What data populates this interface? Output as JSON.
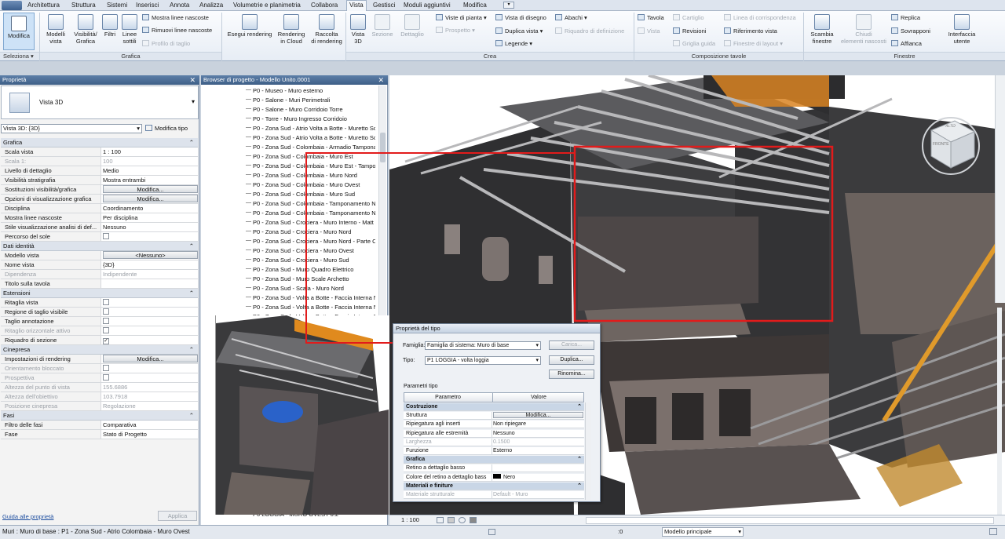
{
  "tabs": [
    "Architettura",
    "Struttura",
    "Sistemi",
    "Inserisci",
    "Annota",
    "Analizza",
    "Volumetrie e planimetria",
    "Collabora",
    "Vista",
    "Gestisci",
    "Moduli aggiuntivi",
    "Modifica"
  ],
  "ribbon": {
    "modifica": "Modifica",
    "seleziona": "Seleziona ▾",
    "modelli": "Modelli\nvista",
    "visibilita": "Visibilità/\nGrafica",
    "filtri": "Filtri",
    "linee": "Linee\nsottili",
    "mostra": "Mostra linee nascoste",
    "rimuovi": "Rimuovi linee nascoste",
    "profilo": "Profilo di taglio",
    "grafica": "Grafica",
    "esegui": "Esegui rendering",
    "cloud": "Rendering\nin Cloud",
    "raccolta": "Raccolta\ndi rendering",
    "vista3d": "Vista\n3D",
    "sezione": "Sezione",
    "dettaglio": "Dettaglio",
    "pianta": "Viste di pianta ▾",
    "prospetto": "Prospetto ▾",
    "vistadisegno": "Vista di disegno",
    "duplica": "Duplica vista ▾",
    "legende": "Legende ▾",
    "abachi": "Abachi ▾",
    "riquadro": "Riquadro di definizione",
    "crea": "Crea",
    "tavola": "Tavola",
    "vista": "Vista",
    "cartiglio": "Cartiglio",
    "revisioni": "Revisioni",
    "griglia": "Griglia guida",
    "corrispondenza": "Linea di corrispondenza",
    "riferimento": "Riferimento vista",
    "finestre": "Finestre di layout ▾",
    "composizione": "Composizione tavole",
    "scambia": "Scambia\nfinestre",
    "chiudi": "Chiudi\nelementi nascosti",
    "replica": "Replica",
    "sovrapponi": "Sovrapponi",
    "affianca": "Affianca",
    "interfaccia": "Interfaccia\nutente",
    "finestregrp": "Finestre"
  },
  "properties": {
    "title": "Proprietà",
    "type_name": "Vista 3D",
    "selector": "Vista 3D: {3D}",
    "edit_type": "Modifica tipo",
    "rows": [
      {
        "s": "Grafica"
      },
      {
        "k": "Scala vista",
        "v": "1 : 100"
      },
      {
        "k": "Scala 1:",
        "v": "100",
        "d": 1
      },
      {
        "k": "Livello di dettaglio",
        "v": "Medio"
      },
      {
        "k": "Visibilità stratigrafia",
        "v": "Mostra entrambi"
      },
      {
        "k": "Sostituzioni visibilità/grafica",
        "v": "Modifica...",
        "b": 1
      },
      {
        "k": "Opzioni di visualizzazione grafica",
        "v": "Modifica...",
        "b": 1
      },
      {
        "k": "Disciplina",
        "v": "Coordinamento"
      },
      {
        "k": "Mostra linee nascoste",
        "v": "Per disciplina"
      },
      {
        "k": "Stile visualizzazione analisi di def...",
        "v": "Nessuno"
      },
      {
        "k": "Percorso del sole",
        "c": ""
      },
      {
        "s": "Dati identità"
      },
      {
        "k": "Modello vista",
        "v": "<Nessuno>",
        "b": 1
      },
      {
        "k": "Nome vista",
        "v": "{3D}"
      },
      {
        "k": "Dipendenza",
        "v": "Indipendente",
        "d": 1
      },
      {
        "k": "Titolo sulla tavola",
        "v": ""
      },
      {
        "s": "Estensioni"
      },
      {
        "k": "Ritaglia vista",
        "c": ""
      },
      {
        "k": "Regione di taglio visibile",
        "c": ""
      },
      {
        "k": "Taglio annotazione",
        "c": ""
      },
      {
        "k": "Ritaglio orizzontale attivo",
        "c": "",
        "d": 1
      },
      {
        "k": "Riquadro di sezione",
        "c": "✓"
      },
      {
        "s": "Cinepresa"
      },
      {
        "k": "Impostazioni di rendering",
        "v": "Modifica...",
        "b": 1
      },
      {
        "k": "Orientamento bloccato",
        "c": "",
        "d": 1
      },
      {
        "k": "Prospettiva",
        "c": "",
        "d": 1
      },
      {
        "k": "Altezza del punto di vista",
        "v": "155.6886",
        "d": 1
      },
      {
        "k": "Altezza dell'obiettivo",
        "v": "103.7918",
        "d": 1
      },
      {
        "k": "Posizione cinepresa",
        "v": "Regolazione",
        "d": 1
      },
      {
        "s": "Fasi"
      },
      {
        "k": "Filtro delle fasi",
        "v": "Comparativa"
      },
      {
        "k": "Fase",
        "v": "Stato di Progetto"
      }
    ],
    "help": "Guida alle proprietà",
    "apply": "Applica"
  },
  "browser": {
    "title": "Browser di progetto - Modello Unito.0001",
    "items": [
      "P0 - Museo - Muro esterno",
      "P0 - Salone - Muri Perimetrali",
      "P0 - Salone - Muro Corridoio Torre",
      "P0 - Torre - Muro Ingresso Corridoio",
      "P0 - Zona Sud - Atrio Volta a Botte - Muretto Sc",
      "P0 - Zona Sud - Atrio Volta a Botte - Muretto Sc",
      "P0 - Zona Sud - Colombaia - Armadio Tampona",
      "P0 - Zona Sud - Colombaia - Muro Est",
      "P0 - Zona Sud - Colombaia - Muro Est - Tampo",
      "P0 - Zona Sud - Colombaia - Muro Nord",
      "P0 - Zona Sud - Colombaia - Muro Ovest",
      "P0 - Zona Sud - Colombaia - Muro Sud",
      "P0 - Zona Sud - Colombaia - Tamponamento N",
      "P0 - Zona Sud - Colombaia - Tamponamento N",
      "P0 - Zona Sud - Crociera - Muro Interno - Matt",
      "P0 - Zona Sud - Crociera - Muro Nord",
      "P0 - Zona Sud - Crociera - Muro Nord - Parte C",
      "P0 - Zona Sud - Crociera - Muro Ovest",
      "P0 - Zona Sud - Crociera - Muro Sud",
      "P0 - Zona Sud - Muro Quadro Elettrico",
      "P0 - Zona Sud - Muro Scale Archetto",
      "P0 - Zona Sud - Scala - Muro Nord",
      "P0 - Zona Sud - Volta a Botte - Faccia Interna N",
      "P0 - Zona Sud - Volta a Botte - Faccia Interna N",
      "P0 - Zona Sud - Volta a Botte - Faccia Interna N"
    ],
    "bottom": "P0 LOGGIA - MURO OVEST 0.2"
  },
  "viewcube": {
    "top": "ALTO",
    "front": "FRONTE"
  },
  "dialog": {
    "title": "Proprietà del tipo",
    "famiglia_lbl": "Famiglia:",
    "famiglia": "Famiglia di sistema: Muro di base",
    "tipo_lbl": "Tipo:",
    "tipo": "P1 LOGGIA - volta loggia",
    "carica": "Carica...",
    "duplica": "Duplica...",
    "rinomina": "Rinomina...",
    "parametri": "Parametri tipo",
    "col_p": "Parametro",
    "col_v": "Valore",
    "rows": [
      {
        "s": "Costruzione"
      },
      {
        "k": "Struttura",
        "v": "Modifica...",
        "b": 1
      },
      {
        "k": "Ripiegatura agli inserti",
        "v": "Non ripiegare"
      },
      {
        "k": "Ripiegatura alle estremità",
        "v": "Nessuno"
      },
      {
        "k": "Larghezza",
        "v": "0.1500",
        "d": 1
      },
      {
        "k": "Funzione",
        "v": "Esterno"
      },
      {
        "s": "Grafica"
      },
      {
        "k": "Retino a dettaglio basso",
        "v": ""
      },
      {
        "k": "Colore del retino a dettaglio bass",
        "v": "Nero"
      },
      {
        "s": "Materiali e finiture"
      },
      {
        "k": "Materiale strutturale",
        "v": "Default - Muro",
        "d": 1
      }
    ]
  },
  "viewbar": {
    "scale": "1 : 100"
  },
  "status": {
    "text": "Muri : Muro di base : P1 - Zona Sud - Atrio Colombaia - Muro Ovest",
    "model": "Modello principale",
    "zero": ":0"
  },
  "colors": {
    "selection": "#e21b1b",
    "ribbon": "#eef2f7",
    "panel_title": "#4a6b93",
    "wall": "#3a3a3c",
    "floor": "#6b625e",
    "roof_orange": "#e08a1e"
  }
}
